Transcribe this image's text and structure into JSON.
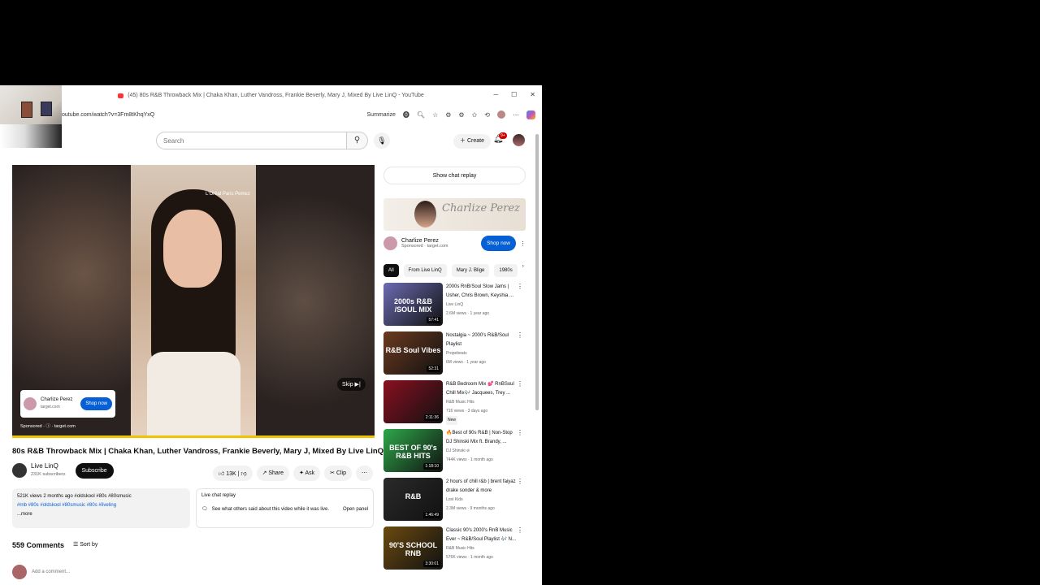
{
  "browser": {
    "tab_title": "(45) 80s R&B Throwback Mix | Chaka Khan, Luther Vandross, Frankie Beverly, Mary J, Mixed By Live LinQ - YouTube",
    "url": "outube.com/watch?v=3Fm8tKhqYxQ",
    "summarize": "Summarize"
  },
  "header": {
    "search_placeholder": "Search",
    "create_label": "Create",
    "notif_count": "9+"
  },
  "player": {
    "brand_tag": "L'Oréal Paris Pemez",
    "ad_name": "Charlize Perez",
    "ad_site": "target.com",
    "shop_label": "Shop now",
    "sponsored": "Sponsored · ⓘ · target.com",
    "skip_label": "Skip ▶|"
  },
  "video": {
    "title": "80s R&B Throwback Mix | Chaka Khan, Luther Vandross, Frankie Beverly, Mary J, Mixed By Live LinQ",
    "channel": "Live LinQ",
    "subscribers": "231K subscribers",
    "subscribe_label": "Subscribe",
    "likes": "13K",
    "share_label": "Share",
    "ask_label": "Ask",
    "clip_label": "Clip",
    "desc_line1": "521K views  2 months ago  #oldskool #80s #80smusic",
    "desc_tags": "#rnb #80s #oldskool #80smusic #80s #liveling",
    "desc_more": "...more",
    "livechat_title": "Live chat replay",
    "livechat_sub": "See what others said about this video while it was live.",
    "open_panel": "Open panel",
    "comments_count": "559 Comments",
    "sort_by": "Sort by",
    "add_comment": "Add a comment..."
  },
  "sidebar": {
    "show_chat": "Show chat replay",
    "ad_name": "Charlize Perez",
    "ad_sub": "Sponsored · target.com",
    "shop_label": "Shop now",
    "chips": [
      "All",
      "From Live LinQ",
      "Mary J. Blige",
      "1980s"
    ],
    "recs": [
      {
        "title": "2000s RnB/Soul Slow Jams | Usher, Chris Brown, Keyshia ...",
        "channel": "Live LinQ",
        "meta": "2.6M views · 1 year ago",
        "dur": "57:41",
        "overlay": "2000s R&B /SOUL MIX",
        "color": "#6c6cb2",
        "new": ""
      },
      {
        "title": "Nostalgia ~ 2000's R&B/Soul Playlist",
        "channel": "Propebeats",
        "meta": "6M views · 1 year ago",
        "dur": "52:31",
        "overlay": "R&B Soul Vibes",
        "color": "#6b3a20",
        "new": ""
      },
      {
        "title": "R&B Bedroom Mix 💕 RnBSoul Chill Mix🎶 Jacquees, Trey ...",
        "channel": "R&B Music Hits",
        "meta": "716 views · 3 days ago",
        "dur": "2:11:36",
        "overlay": "",
        "color": "#8a1020",
        "new": "New"
      },
      {
        "title": "🔥Best of 90s R&B | Non-Stop DJ Shinski Mix ft. Brandy, ...",
        "channel": "DJ Shinski ⊘",
        "meta": "744K views · 1 month ago",
        "dur": "1:18:10",
        "overlay": "BEST OF 90's R&B HITS",
        "color": "#2ea84a",
        "new": ""
      },
      {
        "title": "2 hours of chill r&b | brent faiyaz drake sonder & more",
        "channel": "Lost Kids",
        "meta": "2.3M views · 9 months ago",
        "dur": "1:46:49",
        "overlay": "R&B",
        "color": "#2a2a2a",
        "new": ""
      },
      {
        "title": "Classic 90's 2000's RnB Music Ever ~ R&B/Soul Playlist 🎶 N...",
        "channel": "R&B Music Hits",
        "meta": "576K views · 1 month ago",
        "dur": "3:30:01",
        "overlay": "90'S SCHOOL RNB",
        "color": "#6b4a10",
        "new": ""
      }
    ]
  }
}
